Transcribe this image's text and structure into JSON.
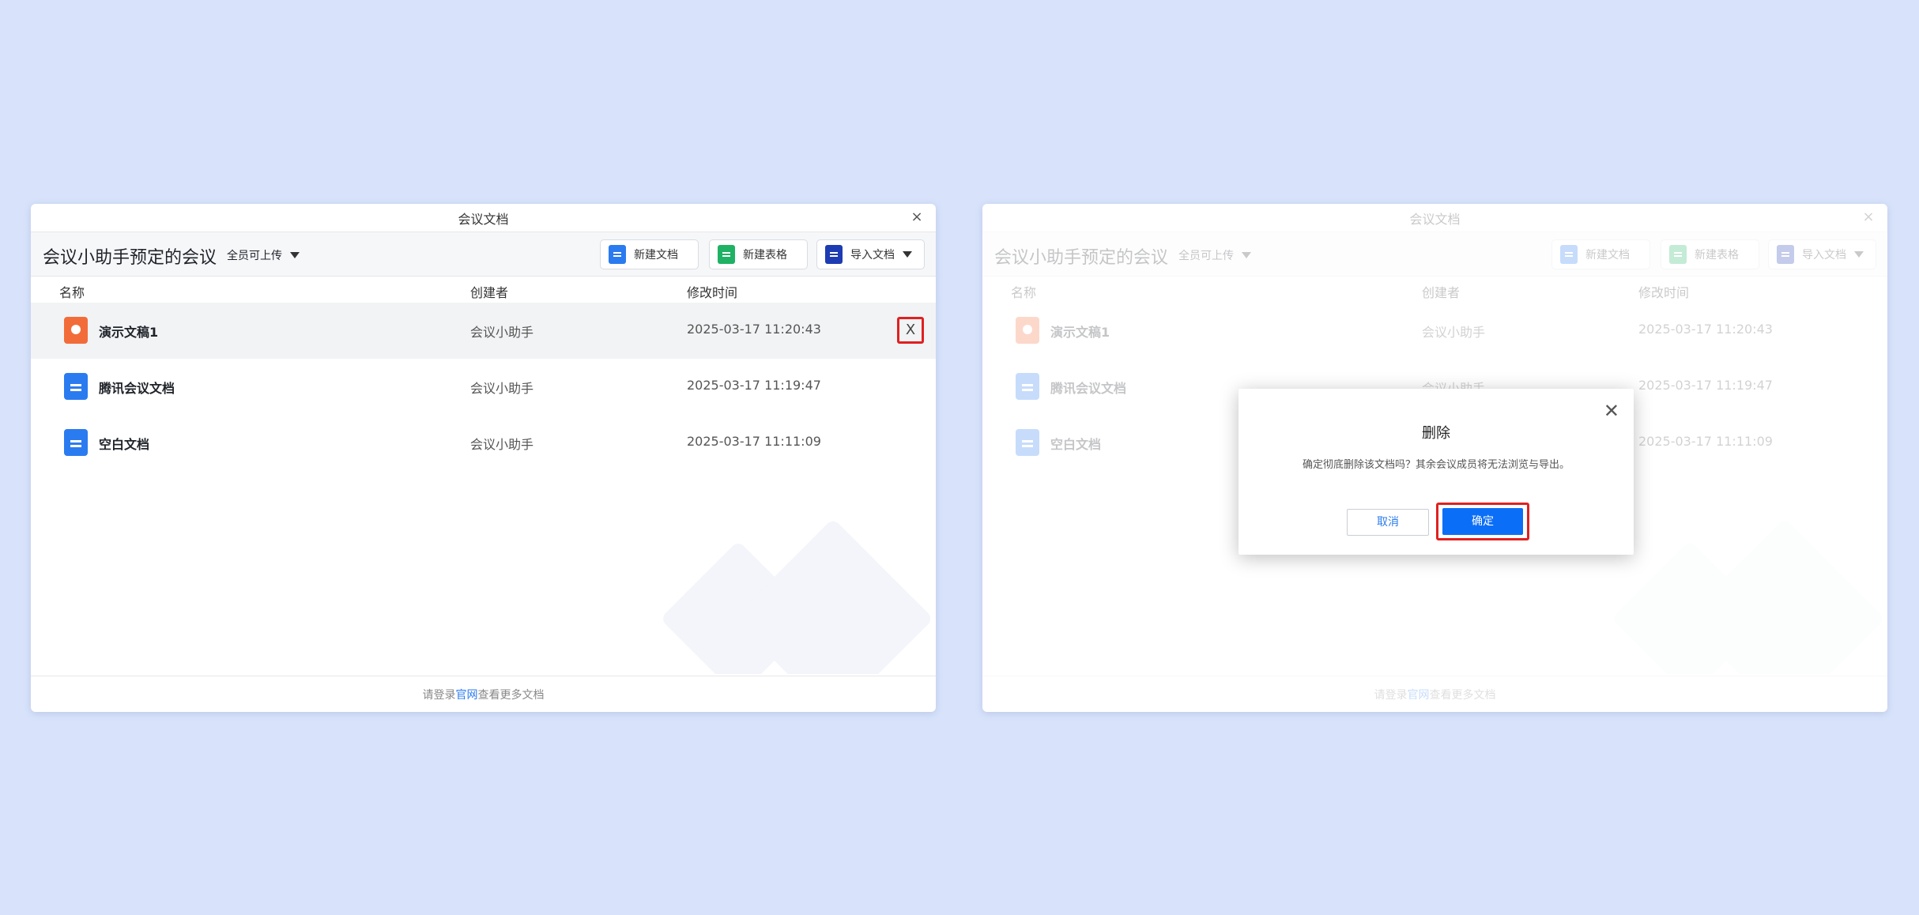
{
  "window": {
    "title": "会议文档",
    "close_glyph": "×",
    "meeting_title": "会议小助手预定的会议",
    "permission": "全员可上传",
    "buttons": {
      "new_doc": "新建文档",
      "new_sheet": "新建表格",
      "import": "导入文档"
    },
    "columns": {
      "name": "名称",
      "creator": "创建者",
      "modified": "修改时间"
    },
    "files": [
      {
        "name": "演示文稿1",
        "creator": "会议小助手",
        "modified": "2025-03-17 11:20:43",
        "icon": "slides-icon"
      },
      {
        "name": "腾讯会议文档",
        "creator": "会议小助手",
        "modified": "2025-03-17 11:19:47",
        "icon": "doc-icon"
      },
      {
        "name": "空白文档",
        "creator": "会议小助手",
        "modified": "2025-03-17 11:11:09",
        "icon": "doc-icon"
      }
    ],
    "delete_glyph": "X",
    "footer": {
      "prefix": "请登录",
      "link": "官网",
      "suffix": "查看更多文档"
    }
  },
  "dialog": {
    "title": "删除",
    "message": "确定彻底删除该文档吗？其余会议成员将无法浏览与导出。",
    "cancel": "取消",
    "confirm": "确定",
    "close_glyph": "✕"
  },
  "colors": {
    "accent": "#0b6ef7",
    "highlight": "#e02020",
    "background": "#d8e3fb"
  }
}
